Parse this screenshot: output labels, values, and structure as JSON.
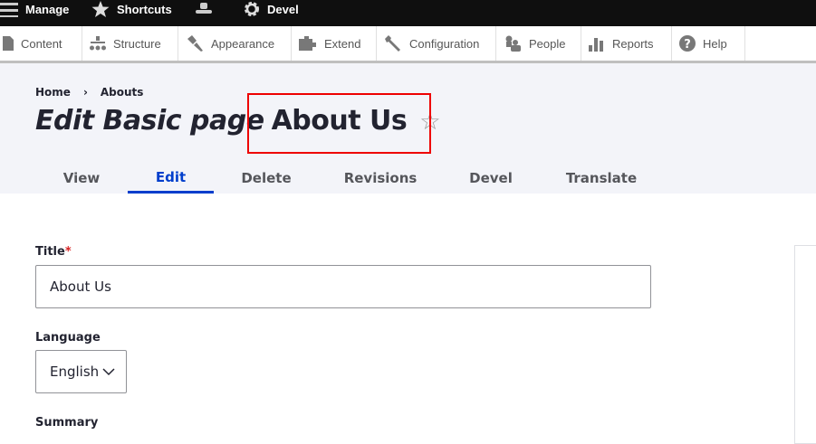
{
  "toolbar": {
    "manage": "Manage",
    "shortcuts": "Shortcuts",
    "devel": "Devel"
  },
  "tray": [
    {
      "label": "Content",
      "icon": "file-icon"
    },
    {
      "label": "Structure",
      "icon": "sitemap-icon"
    },
    {
      "label": "Appearance",
      "icon": "paintbrush-icon"
    },
    {
      "label": "Extend",
      "icon": "puzzle-icon"
    },
    {
      "label": "Configuration",
      "icon": "wrench-icon"
    },
    {
      "label": "People",
      "icon": "people-icon"
    },
    {
      "label": "Reports",
      "icon": "bar-chart-icon"
    },
    {
      "label": "Help",
      "icon": "help-icon"
    }
  ],
  "breadcrumb": {
    "home": "Home",
    "sep": "›",
    "current": "Abouts"
  },
  "page": {
    "title_prefix": "Edit Basic page",
    "title_name": "About Us",
    "star": "☆"
  },
  "tabs": [
    "View",
    "Edit",
    "Delete",
    "Revisions",
    "Devel",
    "Translate"
  ],
  "form": {
    "title_label": "Title",
    "required": "*",
    "title_value": "About Us",
    "language_label": "Language",
    "language_value": "English",
    "summary_label": "Summary"
  },
  "colors": {
    "accent": "#003ecc",
    "highlight": "#e00000"
  }
}
